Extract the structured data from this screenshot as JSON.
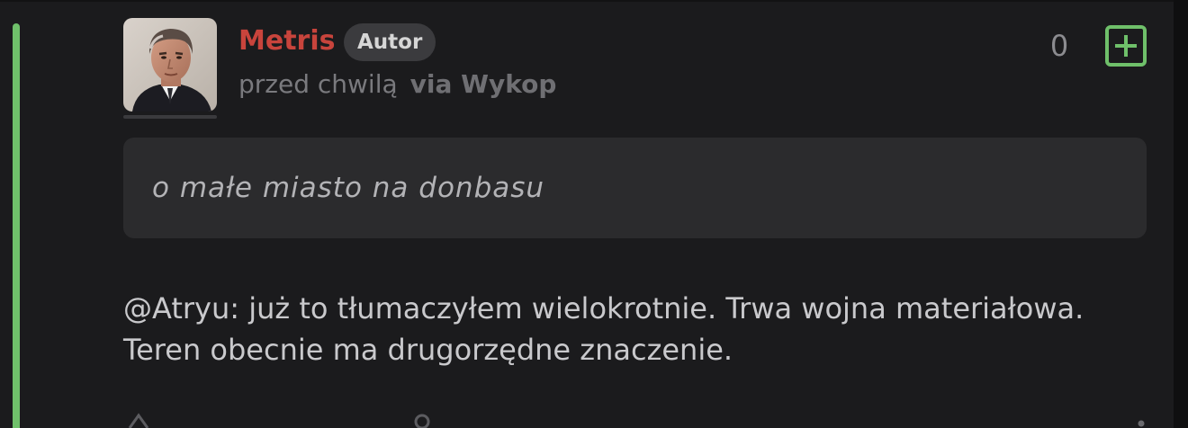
{
  "comment": {
    "author": {
      "name": "Metris",
      "badge": "Autor"
    },
    "meta": {
      "time": "przed chwilą",
      "via": "via Wykop"
    },
    "votes": {
      "count": "0"
    },
    "quote": "o małe miasto na donbasu",
    "body": {
      "line1": "@Atryu: już to tłumaczyłem wielokrotnie. Trwa wojna materiałowa.",
      "line2": "Teren obecnie ma drugorzędne znaczenie."
    }
  },
  "icons": {
    "upvote": "plus-square-icon",
    "share": "share-icon",
    "user": "user-icon",
    "more": "more-dots-icon"
  },
  "colors": {
    "thread_line": "#6fc06a",
    "username": "#c8443c",
    "upvote": "#6fc06a"
  }
}
